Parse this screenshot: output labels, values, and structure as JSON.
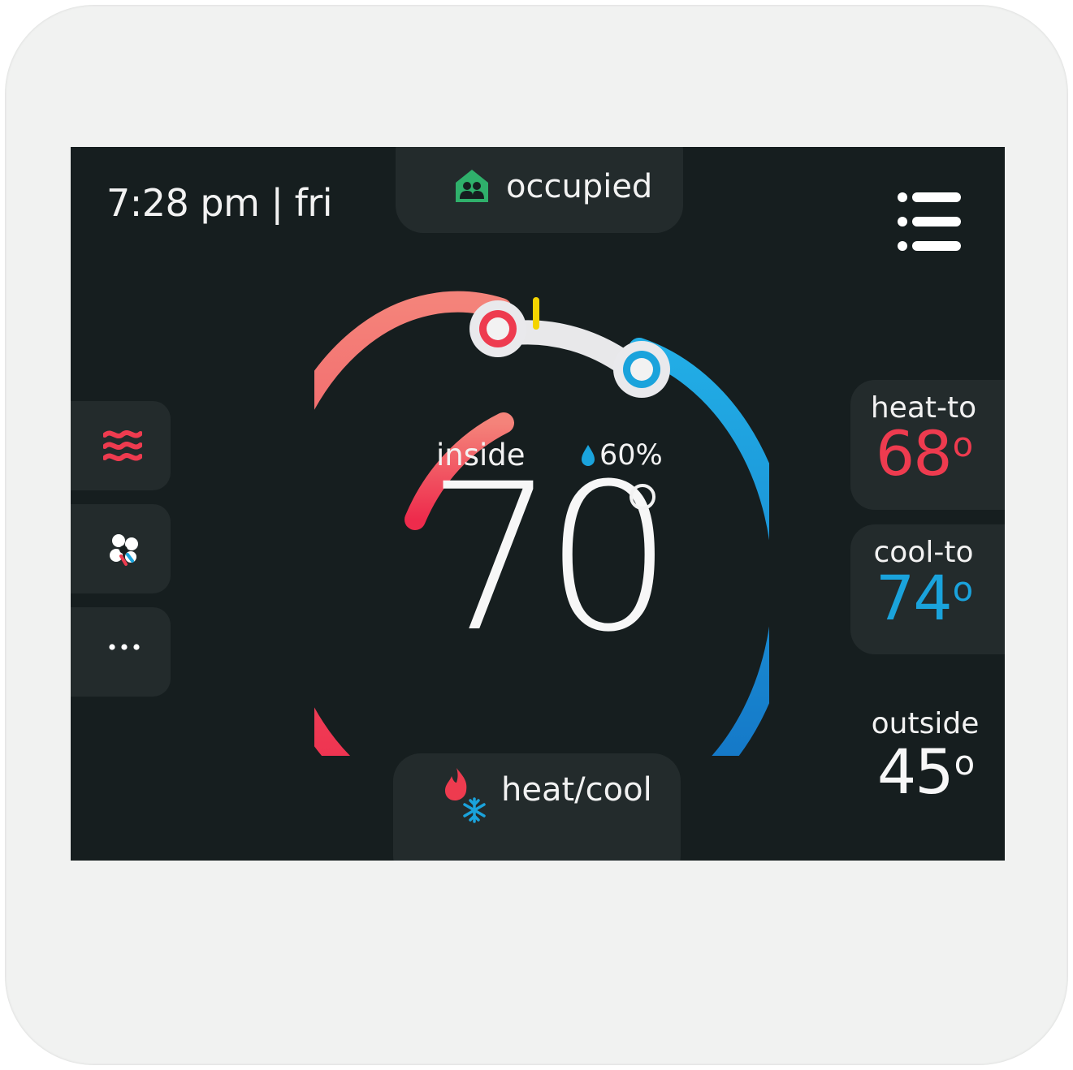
{
  "header": {
    "clock": "7:28 pm | fri",
    "occupancy_label": "occupied"
  },
  "indoor": {
    "label": "inside",
    "temperature": "70",
    "humidity": "60%"
  },
  "setpoints": {
    "heat_label": "heat-to",
    "heat_value": "68",
    "cool_label": "cool-to",
    "cool_value": "74"
  },
  "outdoor": {
    "label": "outside",
    "value": "45"
  },
  "mode": {
    "label": "heat/cool"
  },
  "side_buttons": {
    "more_label": "..."
  },
  "colors": {
    "heat": "#ee3b4f",
    "cool": "#1aa3dc",
    "occupied_green": "#2fb06b",
    "background": "#161e1f"
  },
  "icons": {
    "occupancy": "house-people-icon",
    "menu": "list-menu-icon",
    "heat_mode": "heat-waves-icon",
    "fan": "fan-icon",
    "mode": "flame-snowflake-icon"
  }
}
